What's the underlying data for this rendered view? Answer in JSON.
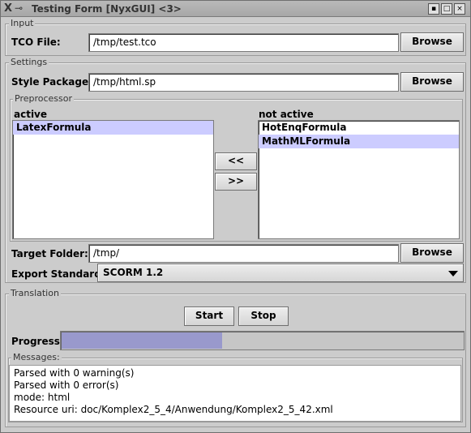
{
  "window": {
    "title": "Testing Form [NyxGUI] <3>",
    "title_icon": "x-icon",
    "pin_icon": "pin-icon",
    "controls": [
      "▪",
      "□",
      "×"
    ]
  },
  "input": {
    "legend": "Input",
    "tco_label": "TCO File:",
    "tco_value": "/tmp/test.tco",
    "browse_label": "Browse"
  },
  "settings": {
    "legend": "Settings",
    "style_label": "Style Package:",
    "style_value": "/tmp/html.sp",
    "browse_label": "Browse",
    "preprocessor": {
      "legend": "Preprocessor",
      "active_label": "active",
      "not_active_label": "not active",
      "active_items": [
        "LatexFormula"
      ],
      "not_active_items": [
        "HotEnqFormula",
        "MathMLFormula"
      ],
      "move_left_label": "<<",
      "move_right_label": ">>"
    },
    "target_label": "Target Folder:",
    "target_value": "/tmp/",
    "target_browse_label": "Browse",
    "export_label": "Export Standard:",
    "export_value": "SCORM 1.2"
  },
  "translation": {
    "legend": "Translation",
    "start_label": "Start",
    "stop_label": "Stop",
    "progress_label": "Progress:",
    "progress_fraction": 0.4,
    "messages_legend": "Messages:",
    "messages": [
      "Parsed with 0 warning(s)",
      "Parsed with 0 error(s)",
      "mode: html",
      "Resource uri: doc/Komplex2_5_4/Anwendung/Komplex2_5_42.xml"
    ]
  },
  "colors": {
    "selection": "#ccccff",
    "progress_fill": "#9999cc",
    "background": "#cccccc"
  }
}
